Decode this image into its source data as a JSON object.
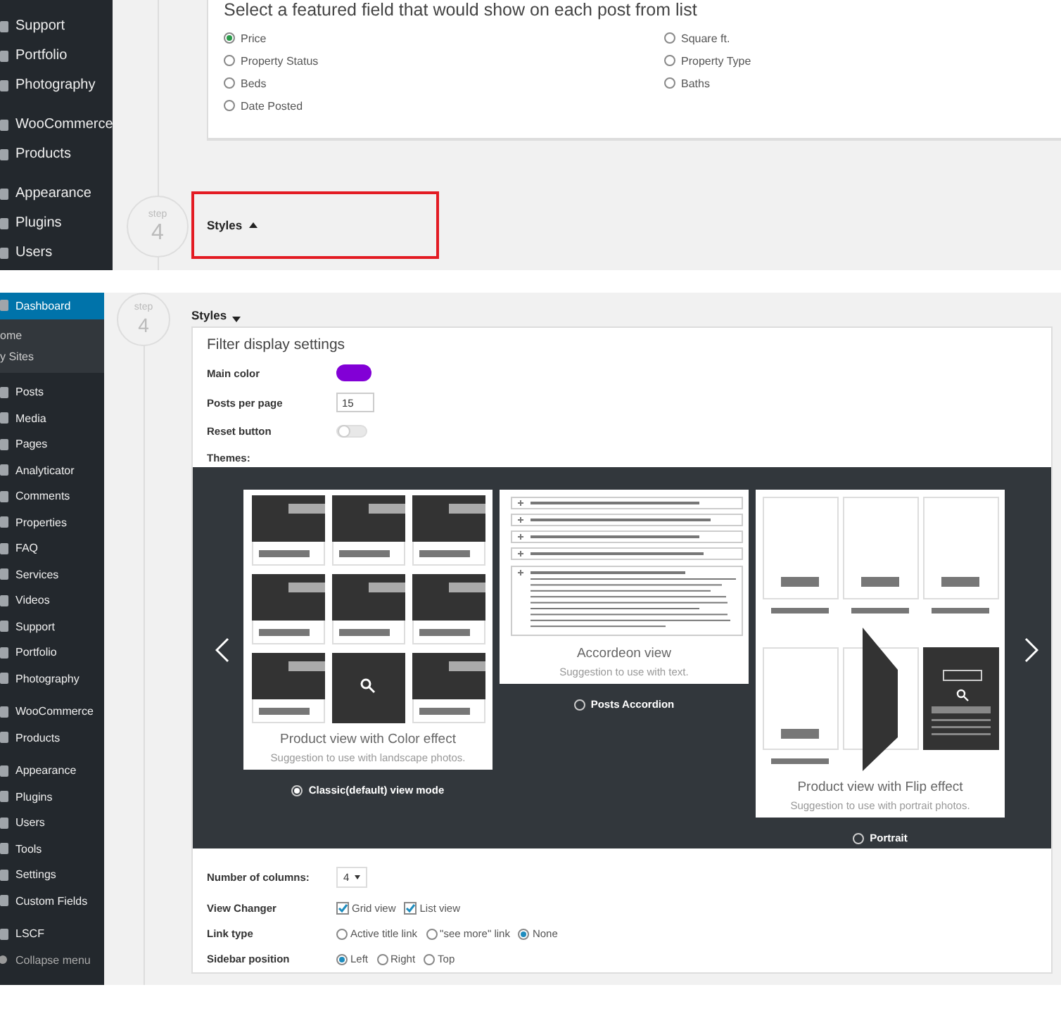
{
  "top_panel": {
    "sidebar": {
      "groups": [
        {
          "items": [
            {
              "label": "Support",
              "kind": "menu",
              "selected": false
            },
            {
              "label": "Portfolio",
              "kind": "menu",
              "selected": false
            },
            {
              "label": "Photography",
              "kind": "menu",
              "selected": false
            }
          ]
        },
        {
          "items": [
            {
              "label": "WooCommerce",
              "kind": "menu",
              "selected": false
            },
            {
              "label": "Products",
              "kind": "menu",
              "selected": false
            }
          ]
        },
        {
          "items": [
            {
              "label": "Appearance",
              "kind": "menu",
              "selected": false
            },
            {
              "label": "Plugins",
              "kind": "menu",
              "selected": false
            },
            {
              "label": "Users",
              "kind": "menu",
              "selected": false
            }
          ]
        }
      ]
    },
    "featured_field": {
      "heading": "Select a featured field that would show on each post from list",
      "columns": [
        [
          {
            "label": "Price",
            "selected": true
          },
          {
            "label": "Property Status",
            "selected": false
          },
          {
            "label": "Beds",
            "selected": false
          },
          {
            "label": "Date Posted",
            "selected": false
          }
        ],
        [
          {
            "label": "Square ft.",
            "selected": false
          },
          {
            "label": "Property Type",
            "selected": false
          },
          {
            "label": "Baths",
            "selected": false
          }
        ]
      ]
    },
    "step": {
      "label": "step",
      "number": "4"
    },
    "section": {
      "title": "Styles",
      "expanded": false,
      "highlighted": true
    }
  },
  "bottom_panel": {
    "sidebar": {
      "groups": [
        {
          "items": [
            {
              "label": "Dashboard",
              "kind": "menu",
              "selected": true
            },
            {
              "label": "ome",
              "kind": "submenu",
              "selected": false
            },
            {
              "label": "y Sites",
              "kind": "submenu",
              "selected": false
            }
          ]
        },
        {
          "items": [
            {
              "label": "Posts",
              "kind": "menu",
              "selected": false
            },
            {
              "label": "Media",
              "kind": "menu",
              "selected": false
            },
            {
              "label": "Pages",
              "kind": "menu",
              "selected": false
            },
            {
              "label": "Analyticator",
              "kind": "menu",
              "selected": false
            },
            {
              "label": "Comments",
              "kind": "menu",
              "selected": false
            },
            {
              "label": "Properties",
              "kind": "menu",
              "selected": false
            },
            {
              "label": "FAQ",
              "kind": "menu",
              "selected": false
            },
            {
              "label": "Services",
              "kind": "menu",
              "selected": false
            },
            {
              "label": "Videos",
              "kind": "menu",
              "selected": false
            },
            {
              "label": "Support",
              "kind": "menu",
              "selected": false
            },
            {
              "label": "Portfolio",
              "kind": "menu",
              "selected": false
            },
            {
              "label": "Photography",
              "kind": "menu",
              "selected": false
            }
          ]
        },
        {
          "items": [
            {
              "label": "WooCommerce",
              "kind": "menu",
              "selected": false
            },
            {
              "label": "Products",
              "kind": "menu",
              "selected": false
            }
          ]
        },
        {
          "items": [
            {
              "label": "Appearance",
              "kind": "menu",
              "selected": false
            },
            {
              "label": "Plugins",
              "kind": "menu",
              "selected": false
            },
            {
              "label": "Users",
              "kind": "menu",
              "selected": false
            },
            {
              "label": "Tools",
              "kind": "menu",
              "selected": false
            },
            {
              "label": "Settings",
              "kind": "menu",
              "selected": false
            },
            {
              "label": "Custom Fields",
              "kind": "menu",
              "selected": false
            }
          ]
        },
        {
          "items": [
            {
              "label": "LSCF",
              "kind": "menu",
              "selected": false
            },
            {
              "label": "Collapse menu",
              "kind": "collapse",
              "selected": false
            }
          ]
        }
      ]
    },
    "step": {
      "label": "step",
      "number": "4"
    },
    "section": {
      "title": "Styles",
      "expanded": true
    },
    "settings": {
      "title": "Filter display settings",
      "main_color": {
        "label": "Main color",
        "color": "#8200d6"
      },
      "posts_per_page": {
        "label": "Posts per page",
        "value": "15"
      },
      "reset_button": {
        "label": "Reset button",
        "on": false
      },
      "themes": {
        "label": "Themes:",
        "items": [
          {
            "kind": "grid",
            "title": "Product view with Color effect",
            "hint": "Suggestion to use with landscape photos.",
            "option": "Classic(default) view mode",
            "selected": true
          },
          {
            "kind": "accordion",
            "title": "Accordeon view",
            "hint": "Suggestion to use with text.",
            "option": "Posts Accordion",
            "selected": false
          },
          {
            "kind": "flip",
            "title": "Product view with Flip effect",
            "hint": "Suggestion to use with portrait photos.",
            "option": "Portrait",
            "selected": false
          }
        ]
      },
      "columns": {
        "label": "Number of columns:",
        "value": "4"
      },
      "view_changer": {
        "label": "View Changer",
        "options": [
          {
            "label": "Grid view",
            "checked": true
          },
          {
            "label": "List view",
            "checked": true
          }
        ]
      },
      "link_type": {
        "label": "Link type",
        "options": [
          {
            "label": "Active title link",
            "selected": false
          },
          {
            "label": "\"see more\" link",
            "selected": false
          },
          {
            "label": "None",
            "selected": true
          }
        ]
      },
      "sidebar_position": {
        "label": "Sidebar position",
        "options": [
          {
            "label": "Left",
            "selected": true
          },
          {
            "label": "Right",
            "selected": false
          },
          {
            "label": "Top",
            "selected": false
          }
        ]
      }
    }
  }
}
